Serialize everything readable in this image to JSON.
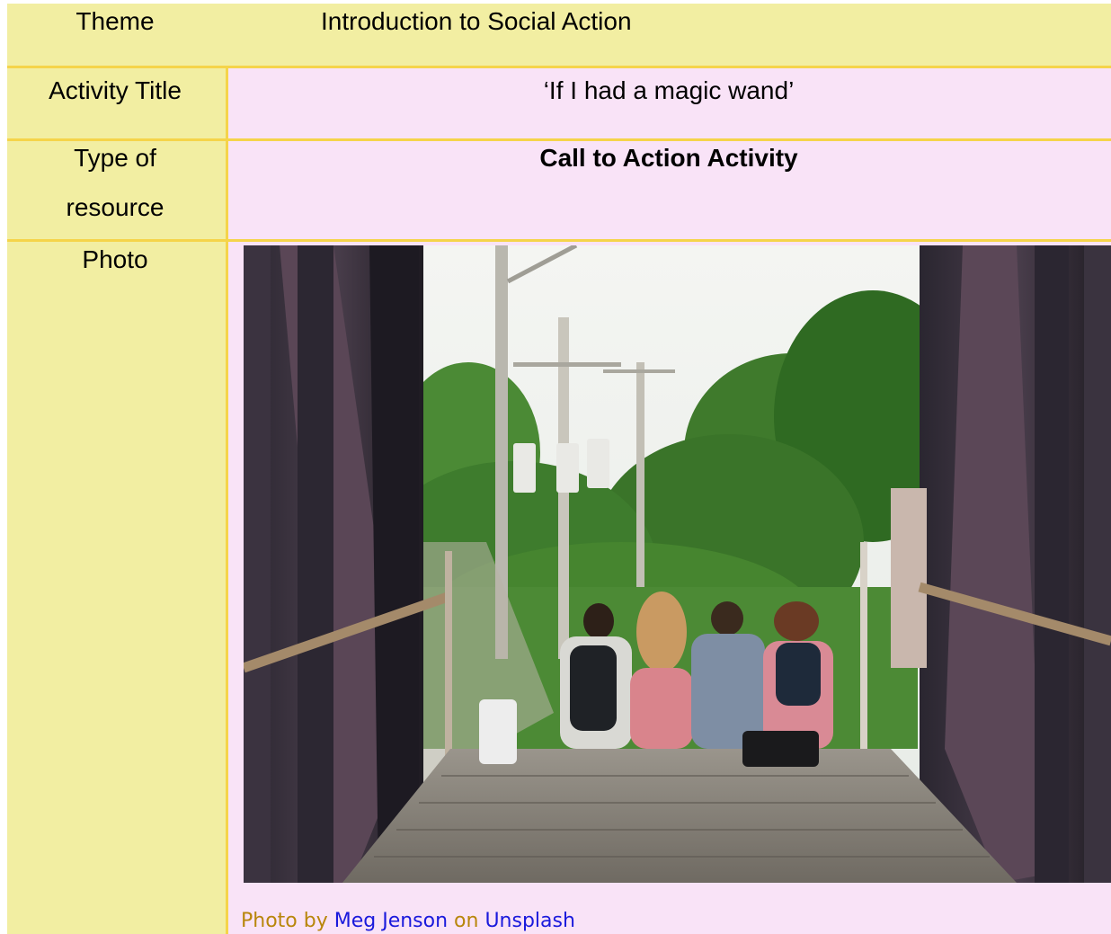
{
  "rows": {
    "theme": {
      "label": "Theme",
      "value": "Introduction to Social Action"
    },
    "activity_title": {
      "label": "Activity Title",
      "value": "‘If I had a magic wand’"
    },
    "type_of_resource": {
      "label_line1": "Type of",
      "label_line2": "resource",
      "value": "Call to Action Activity"
    },
    "photo": {
      "label": "Photo"
    }
  },
  "photo_credit": {
    "prefix": "Photo by",
    "author": "Meg Jenson",
    "middle": "on",
    "site": "Unsplash"
  },
  "colors": {
    "label_bg": "#f2eea2",
    "value_bg": "#f9e3f7",
    "border": "#f5d44a",
    "credit_text": "#b8860b",
    "link": "#1a1adc"
  }
}
